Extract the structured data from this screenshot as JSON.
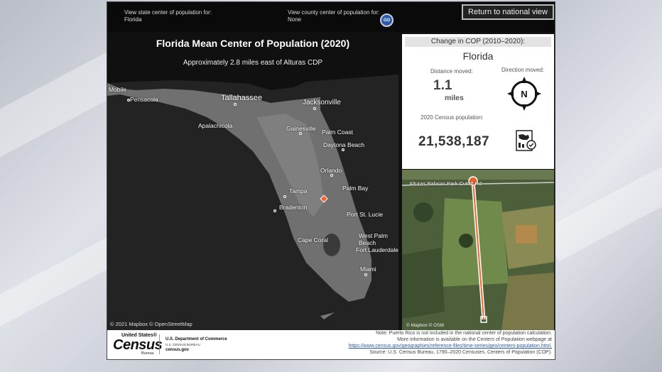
{
  "topbar": {
    "state_label": "View state center of population for:",
    "state_value": "Florida",
    "county_label": "View county center of population for:",
    "county_value": "None",
    "go_label": "GO",
    "return_label": "Return to national view"
  },
  "map": {
    "title": "Florida Mean Center of Population (2020)",
    "subtitle": "Approximately 2.8 miles east of Alturas CDP",
    "credit": "© 2021 Mapbox © OpenStreetMap",
    "cities": [
      "Mobile",
      "Pensacola",
      "Tallahassee",
      "Jacksonville",
      "Apalachicola",
      "Gainesville",
      "Palm Coast",
      "Daytona Beach",
      "Orlando",
      "Tampa",
      "Palm Bay",
      "Bradenton",
      "Port St. Lucie",
      "Cape Coral",
      "West Palm Beach",
      "Fort Lauderdale",
      "Miami"
    ]
  },
  "panel": {
    "header": "Change in COP (2010–2020):",
    "state": "Florida",
    "distance_label": "Distance moved:",
    "distance_value": "1.1",
    "distance_unit": "miles",
    "direction_label": "Direction moved:",
    "direction_value": "N",
    "population_label": "2020 Census population:",
    "population_value": "21,538,187"
  },
  "inset": {
    "road_label": "Alturas Babson Park Cutoff Rd",
    "credit": "© Mapbox © OSM"
  },
  "footer": {
    "logo_top": "United States®",
    "logo_main": "Census",
    "logo_bottom": "Bureau",
    "dept": "U.S. Department of Commerce",
    "dept_sub": "U.S. CENSUS BUREAU",
    "site": "census.gov",
    "note1": "Note: Puerto Rico is not included in the national center of population calculation.",
    "note2": "More information is available on the Centers of Population webpage at",
    "link": "https://www.census.gov/geographies/reference-files/time-series/geo/centers-population.html.",
    "source": "Source: U.S. Census Bureau, 1790–2020 Censuses, Centers of Population (COP)."
  }
}
